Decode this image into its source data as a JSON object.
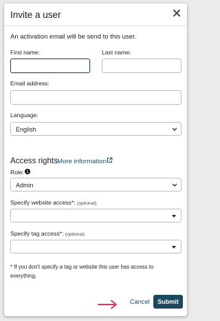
{
  "modal": {
    "title": "Invite a user",
    "intro": "An activation email will be send to this user."
  },
  "form": {
    "first_name_label": "First name:",
    "first_name_value": "",
    "last_name_label": "Last name:",
    "last_name_value": "",
    "email_label": "Email address:",
    "email_value": "",
    "language_label": "Language:",
    "language_value": "English"
  },
  "access": {
    "title": "Access rights",
    "more_info": "More information",
    "role_label": "Role:",
    "role_value": "Admin",
    "website_label": "Specify website access*:",
    "website_optional": "(optional)",
    "website_value": "",
    "tag_label": "Specify tag access*:",
    "tag_optional": "(optional)",
    "tag_value": "",
    "note": "* If you don't specify a tag or website this user has access to everything."
  },
  "footer": {
    "cancel_label": "Cancel",
    "submit_label": "Submit"
  },
  "colors": {
    "accent": "#1b4a5f",
    "arrow": "#e8344a"
  },
  "icons": [
    "close-icon",
    "external-link-icon",
    "info-icon",
    "chevron-down-icon",
    "caret-down-icon",
    "arrow-right-icon"
  ]
}
